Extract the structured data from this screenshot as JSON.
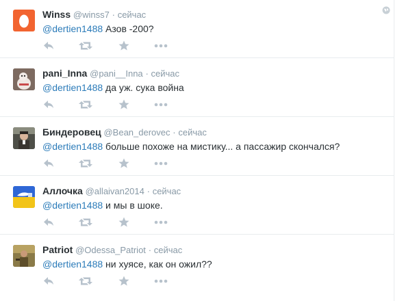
{
  "colors": {
    "mention": "#2b7bb9",
    "muted": "#8899a6",
    "action_icon": "#b7c2cc"
  },
  "tweets": [
    {
      "name": "Winss",
      "handle": "@winss7",
      "time": "сейчас",
      "mention": "@dertien1488",
      "text": " Азов -200?",
      "avatar_icon": "egg-icon",
      "has_globe": true
    },
    {
      "name": "pani_Inna",
      "handle": "@pani__Inna",
      "time": "сейчас",
      "mention": "@dertien1488",
      "text": " да уж. сука война",
      "avatar_icon": "avatar-photo"
    },
    {
      "name": "Биндеровец",
      "handle": "@Bean_derovec",
      "time": "сейчас",
      "mention": "@dertien1488",
      "text": " больше похоже на мистику... а пассажир скончался?",
      "avatar_icon": "avatar-photo"
    },
    {
      "name": "Аллочка",
      "handle": "@allaivan2014",
      "time": "сейчас",
      "mention": "@dertien1488",
      "text": " и мы в шоке.",
      "avatar_icon": "avatar-photo"
    },
    {
      "name": "Patriot",
      "handle": "@Odessa_Patriot",
      "time": "сейчас",
      "mention": "@dertien1488",
      "text": " ни хуясе, как он ожил??",
      "avatar_icon": "avatar-photo"
    }
  ],
  "actions": [
    "reply-icon",
    "retweet-icon",
    "favorite-icon",
    "more-icon"
  ],
  "separator": "·"
}
